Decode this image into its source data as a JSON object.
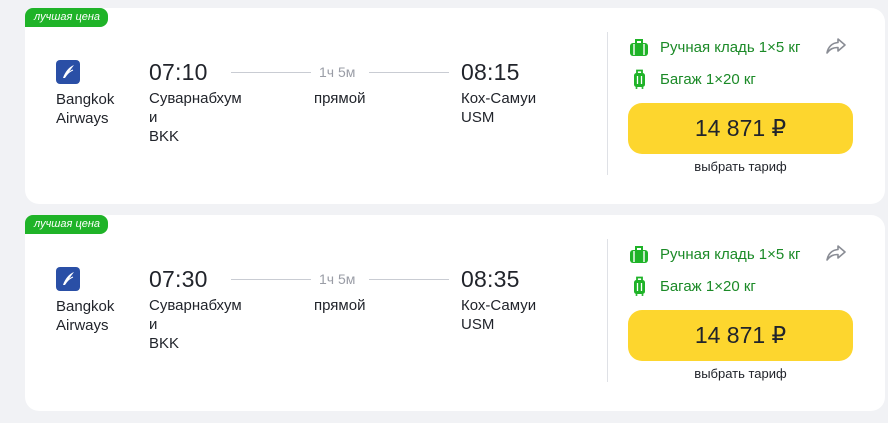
{
  "flights": [
    {
      "badge": "лучшая цена",
      "airline_line1": "Bangkok",
      "airline_line2": "Airways",
      "departure_time": "07:10",
      "departure_place_line1": "Суварнабхум",
      "departure_place_line2": "и",
      "departure_code": "BKK",
      "duration": "1ч 5м",
      "stops": "прямой",
      "arrival_time": "08:15",
      "arrival_place": "Кох-Самуи",
      "arrival_code": "USM",
      "hand_luggage": "Ручная кладь 1×5 кг",
      "baggage": "Багаж 1×20 кг",
      "price": "14 871 ₽",
      "select_tariff": "выбрать тариф"
    },
    {
      "badge": "лучшая цена",
      "airline_line1": "Bangkok",
      "airline_line2": "Airways",
      "departure_time": "07:30",
      "departure_place_line1": "Суварнабхум",
      "departure_place_line2": "и",
      "departure_code": "BKK",
      "duration": "1ч 5м",
      "stops": "прямой",
      "arrival_time": "08:35",
      "arrival_place": "Кох-Самуи",
      "arrival_code": "USM",
      "hand_luggage": "Ручная кладь 1×5 кг",
      "baggage": "Багаж 1×20 кг",
      "price": "14 871 ₽",
      "select_tariff": "выбрать тариф"
    }
  ],
  "icons": {
    "airline_logo": "bangkok-airways-logo",
    "hand_luggage": "suitcase-icon",
    "baggage": "luggage-icon",
    "share": "share-arrow-icon"
  },
  "colors": {
    "badge_green": "#1fb328",
    "luggage_green": "#1b8a27",
    "price_yellow": "#fdd62e",
    "logo_blue": "#2a4fa6"
  }
}
